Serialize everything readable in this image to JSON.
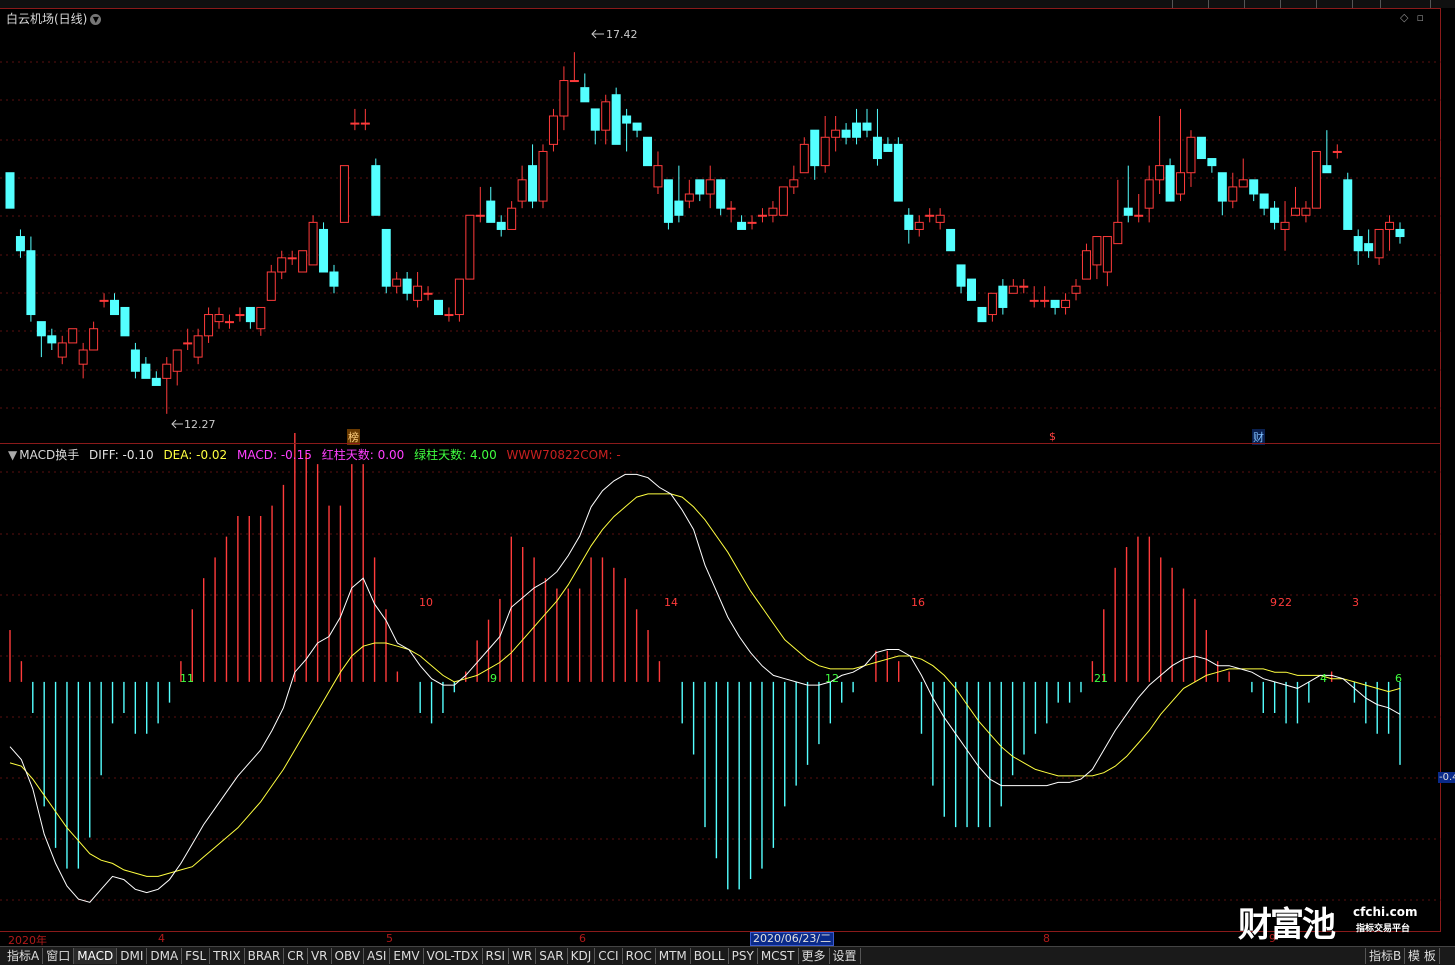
{
  "stock_title": "白云机场(日线)",
  "price_max_label": "17.42",
  "price_min_label": "12.27",
  "markers": {
    "bang": "榜",
    "rong": "$",
    "cai": "财"
  },
  "macd": {
    "name": "MACD换手",
    "diff_label": "DIFF: -0.10",
    "dea_label": "DEA: -0.02",
    "macd_label": "MACD: -0.15",
    "red_days_label": "红柱天数: 0.00",
    "green_days_label": "绿柱天数: 4.00",
    "site_label": "WWW70822COM: -"
  },
  "colors": {
    "up": "#ff3b3b",
    "down": "#54ffff",
    "diff": "#ffffff",
    "dea": "#ffff40",
    "red_bar": "#ff3b3b",
    "green_bar": "#54ffff",
    "grid": "#5a0f0f"
  },
  "dates": {
    "year": "2020年",
    "m4": "4",
    "m5": "5",
    "m6": "6",
    "current": "2020/06/23/二",
    "m8": "8",
    "m9": "9"
  },
  "macd_right_label": "-0.4",
  "bar_counts": [
    {
      "text": "11",
      "color": "green"
    },
    {
      "text": "10",
      "color": "red"
    },
    {
      "text": "9",
      "color": "green"
    },
    {
      "text": "14",
      "color": "red"
    },
    {
      "text": "12",
      "color": "green"
    },
    {
      "text": "16",
      "color": "red"
    },
    {
      "text": "21",
      "color": "green"
    },
    {
      "text": "22",
      "color": "red"
    },
    {
      "text": "9",
      "color": "red"
    },
    {
      "text": "3",
      "color": "red"
    },
    {
      "text": "4",
      "color": "green"
    },
    {
      "text": "6",
      "color": "green"
    }
  ],
  "tabs": [
    "指标A",
    "窗口",
    "MACD",
    "DMI",
    "DMA",
    "FSL",
    "TRIX",
    "BRAR",
    "CR",
    "VR",
    "OBV",
    "ASI",
    "EMV",
    "VOL-TDX",
    "RSI",
    "WR",
    "SAR",
    "KDJ",
    "CCI",
    "ROC",
    "MTM",
    "BOLL",
    "PSY",
    "MCST",
    "更多",
    "设置"
  ],
  "right_tabs": [
    "指标B",
    "模 板"
  ],
  "logo": {
    "main": "财富池",
    "domain": "cfchi.com",
    "tagline": "指标交易平台"
  },
  "candles": [
    {
      "o": 15.7,
      "h": 15.7,
      "l": 15.2,
      "c": 15.2
    },
    {
      "o": 14.8,
      "h": 14.9,
      "l": 14.5,
      "c": 14.6
    },
    {
      "o": 14.6,
      "h": 14.8,
      "l": 13.6,
      "c": 13.7
    },
    {
      "o": 13.6,
      "h": 13.6,
      "l": 13.1,
      "c": 13.4
    },
    {
      "o": 13.4,
      "h": 13.5,
      "l": 13.2,
      "c": 13.3
    },
    {
      "o": 13.1,
      "h": 13.4,
      "l": 13.0,
      "c": 13.3
    },
    {
      "o": 13.3,
      "h": 13.5,
      "l": 13.3,
      "c": 13.5
    },
    {
      "o": 13.0,
      "h": 13.3,
      "l": 12.8,
      "c": 13.2
    },
    {
      "o": 13.2,
      "h": 13.6,
      "l": 13.2,
      "c": 13.5
    },
    {
      "o": 13.9,
      "h": 14.0,
      "l": 13.8,
      "c": 13.9
    },
    {
      "o": 13.9,
      "h": 14.0,
      "l": 13.7,
      "c": 13.7
    },
    {
      "o": 13.8,
      "h": 13.8,
      "l": 13.4,
      "c": 13.4
    },
    {
      "o": 13.2,
      "h": 13.3,
      "l": 12.8,
      "c": 12.9
    },
    {
      "o": 13.0,
      "h": 13.1,
      "l": 12.8,
      "c": 12.8
    },
    {
      "o": 12.8,
      "h": 12.9,
      "l": 12.7,
      "c": 12.7
    },
    {
      "o": 12.8,
      "h": 13.1,
      "l": 12.3,
      "c": 13.0
    },
    {
      "o": 12.9,
      "h": 13.2,
      "l": 12.7,
      "c": 13.2
    },
    {
      "o": 13.3,
      "h": 13.5,
      "l": 13.2,
      "c": 13.3
    },
    {
      "o": 13.1,
      "h": 13.5,
      "l": 13.0,
      "c": 13.4
    },
    {
      "o": 13.4,
      "h": 13.8,
      "l": 13.3,
      "c": 13.7
    },
    {
      "o": 13.6,
      "h": 13.8,
      "l": 13.5,
      "c": 13.7
    },
    {
      "o": 13.6,
      "h": 13.7,
      "l": 13.5,
      "c": 13.6
    },
    {
      "o": 13.7,
      "h": 13.8,
      "l": 13.6,
      "c": 13.7
    },
    {
      "o": 13.8,
      "h": 13.8,
      "l": 13.5,
      "c": 13.6
    },
    {
      "o": 13.5,
      "h": 13.8,
      "l": 13.4,
      "c": 13.8
    },
    {
      "o": 13.9,
      "h": 14.4,
      "l": 13.9,
      "c": 14.3
    },
    {
      "o": 14.3,
      "h": 14.6,
      "l": 14.2,
      "c": 14.5
    },
    {
      "o": 14.5,
      "h": 14.6,
      "l": 14.4,
      "c": 14.5
    },
    {
      "o": 14.3,
      "h": 14.6,
      "l": 14.3,
      "c": 14.6
    },
    {
      "o": 14.4,
      "h": 15.1,
      "l": 14.4,
      "c": 15.0
    },
    {
      "o": 14.9,
      "h": 15.0,
      "l": 14.3,
      "c": 14.3
    },
    {
      "o": 14.3,
      "h": 14.4,
      "l": 14.0,
      "c": 14.1
    },
    {
      "o": 15.0,
      "h": 15.8,
      "l": 15.0,
      "c": 15.8
    },
    {
      "o": 16.4,
      "h": 16.6,
      "l": 16.3,
      "c": 16.4
    },
    {
      "o": 16.4,
      "h": 16.6,
      "l": 16.3,
      "c": 16.4
    },
    {
      "o": 15.8,
      "h": 15.9,
      "l": 15.1,
      "c": 15.1
    },
    {
      "o": 14.9,
      "h": 14.9,
      "l": 14.0,
      "c": 14.1
    },
    {
      "o": 14.1,
      "h": 14.3,
      "l": 14.0,
      "c": 14.2
    },
    {
      "o": 14.2,
      "h": 14.3,
      "l": 13.9,
      "c": 14.0
    },
    {
      "o": 13.9,
      "h": 14.3,
      "l": 13.8,
      "c": 14.1
    },
    {
      "o": 14.0,
      "h": 14.1,
      "l": 13.9,
      "c": 14.0
    },
    {
      "o": 13.9,
      "h": 13.9,
      "l": 13.7,
      "c": 13.7
    },
    {
      "o": 13.7,
      "h": 13.8,
      "l": 13.6,
      "c": 13.7
    },
    {
      "o": 13.7,
      "h": 14.2,
      "l": 13.6,
      "c": 14.2
    },
    {
      "o": 14.2,
      "h": 15.1,
      "l": 14.2,
      "c": 15.1
    },
    {
      "o": 15.1,
      "h": 15.5,
      "l": 15.0,
      "c": 15.1
    },
    {
      "o": 15.3,
      "h": 15.5,
      "l": 15.0,
      "c": 15.0
    },
    {
      "o": 15.0,
      "h": 15.1,
      "l": 14.8,
      "c": 14.9
    },
    {
      "o": 14.9,
      "h": 15.3,
      "l": 14.9,
      "c": 15.2
    },
    {
      "o": 15.3,
      "h": 15.8,
      "l": 15.2,
      "c": 15.6
    },
    {
      "o": 15.8,
      "h": 16.1,
      "l": 15.2,
      "c": 15.3
    },
    {
      "o": 15.3,
      "h": 16.1,
      "l": 15.2,
      "c": 16.0
    },
    {
      "o": 16.1,
      "h": 16.6,
      "l": 16.0,
      "c": 16.5
    },
    {
      "o": 16.5,
      "h": 17.2,
      "l": 16.3,
      "c": 17.0
    },
    {
      "o": 17.0,
      "h": 17.4,
      "l": 17.0,
      "c": 17.0
    },
    {
      "o": 16.9,
      "h": 17.1,
      "l": 16.7,
      "c": 16.7
    },
    {
      "o": 16.6,
      "h": 16.6,
      "l": 16.1,
      "c": 16.3
    },
    {
      "o": 16.3,
      "h": 16.8,
      "l": 16.1,
      "c": 16.7
    },
    {
      "o": 16.8,
      "h": 16.9,
      "l": 16.1,
      "c": 16.1
    },
    {
      "o": 16.5,
      "h": 16.6,
      "l": 16.0,
      "c": 16.4
    },
    {
      "o": 16.4,
      "h": 16.4,
      "l": 16.2,
      "c": 16.3
    },
    {
      "o": 16.2,
      "h": 16.2,
      "l": 15.8,
      "c": 15.8
    },
    {
      "o": 15.5,
      "h": 16.0,
      "l": 15.4,
      "c": 15.8
    },
    {
      "o": 15.6,
      "h": 15.6,
      "l": 14.9,
      "c": 15.0
    },
    {
      "o": 15.3,
      "h": 15.8,
      "l": 15.0,
      "c": 15.1
    },
    {
      "o": 15.3,
      "h": 15.6,
      "l": 15.2,
      "c": 15.4
    },
    {
      "o": 15.6,
      "h": 15.6,
      "l": 15.3,
      "c": 15.4
    },
    {
      "o": 15.4,
      "h": 15.8,
      "l": 15.2,
      "c": 15.6
    },
    {
      "o": 15.6,
      "h": 15.6,
      "l": 15.1,
      "c": 15.2
    },
    {
      "o": 15.2,
      "h": 15.3,
      "l": 15.0,
      "c": 15.2
    },
    {
      "o": 15.0,
      "h": 15.1,
      "l": 14.9,
      "c": 14.9
    },
    {
      "o": 15.0,
      "h": 15.1,
      "l": 14.9,
      "c": 15.0
    },
    {
      "o": 15.1,
      "h": 15.2,
      "l": 15.0,
      "c": 15.1
    },
    {
      "o": 15.1,
      "h": 15.3,
      "l": 15.0,
      "c": 15.2
    },
    {
      "o": 15.1,
      "h": 15.5,
      "l": 15.1,
      "c": 15.5
    },
    {
      "o": 15.5,
      "h": 15.8,
      "l": 15.4,
      "c": 15.6
    },
    {
      "o": 15.7,
      "h": 16.2,
      "l": 15.7,
      "c": 16.1
    },
    {
      "o": 16.3,
      "h": 16.3,
      "l": 15.6,
      "c": 15.8
    },
    {
      "o": 15.8,
      "h": 16.5,
      "l": 15.7,
      "c": 16.2
    },
    {
      "o": 16.2,
      "h": 16.5,
      "l": 16.0,
      "c": 16.3
    },
    {
      "o": 16.3,
      "h": 16.4,
      "l": 16.1,
      "c": 16.2
    },
    {
      "o": 16.4,
      "h": 16.6,
      "l": 16.1,
      "c": 16.2
    },
    {
      "o": 16.4,
      "h": 16.6,
      "l": 16.2,
      "c": 16.3
    },
    {
      "o": 16.2,
      "h": 16.6,
      "l": 15.8,
      "c": 15.9
    },
    {
      "o": 16.1,
      "h": 16.2,
      "l": 16.0,
      "c": 16.0
    },
    {
      "o": 16.1,
      "h": 16.2,
      "l": 15.3,
      "c": 15.3
    },
    {
      "o": 15.1,
      "h": 15.2,
      "l": 14.7,
      "c": 14.9
    },
    {
      "o": 14.9,
      "h": 15.1,
      "l": 14.8,
      "c": 15.0
    },
    {
      "o": 15.1,
      "h": 15.2,
      "l": 15.0,
      "c": 15.1
    },
    {
      "o": 15.0,
      "h": 15.2,
      "l": 14.9,
      "c": 15.1
    },
    {
      "o": 14.9,
      "h": 14.9,
      "l": 14.6,
      "c": 14.6
    },
    {
      "o": 14.4,
      "h": 14.4,
      "l": 14.0,
      "c": 14.1
    },
    {
      "o": 14.2,
      "h": 14.2,
      "l": 13.9,
      "c": 13.9
    },
    {
      "o": 13.8,
      "h": 13.8,
      "l": 13.6,
      "c": 13.6
    },
    {
      "o": 13.7,
      "h": 14.0,
      "l": 13.6,
      "c": 14.0
    },
    {
      "o": 14.1,
      "h": 14.2,
      "l": 13.7,
      "c": 13.8
    },
    {
      "o": 14.0,
      "h": 14.2,
      "l": 14.0,
      "c": 14.1
    },
    {
      "o": 14.1,
      "h": 14.2,
      "l": 14.0,
      "c": 14.1
    },
    {
      "o": 13.9,
      "h": 14.1,
      "l": 13.8,
      "c": 13.9
    },
    {
      "o": 13.9,
      "h": 14.1,
      "l": 13.8,
      "c": 13.9
    },
    {
      "o": 13.9,
      "h": 13.9,
      "l": 13.7,
      "c": 13.8
    },
    {
      "o": 13.8,
      "h": 14.0,
      "l": 13.7,
      "c": 13.9
    },
    {
      "o": 14.0,
      "h": 14.2,
      "l": 13.9,
      "c": 14.1
    },
    {
      "o": 14.2,
      "h": 14.7,
      "l": 14.2,
      "c": 14.6
    },
    {
      "o": 14.4,
      "h": 14.8,
      "l": 14.2,
      "c": 14.8
    },
    {
      "o": 14.3,
      "h": 14.8,
      "l": 14.1,
      "c": 14.8
    },
    {
      "o": 14.7,
      "h": 15.6,
      "l": 14.7,
      "c": 15.0
    },
    {
      "o": 15.2,
      "h": 15.8,
      "l": 15.0,
      "c": 15.1
    },
    {
      "o": 15.1,
      "h": 15.4,
      "l": 15.0,
      "c": 15.1
    },
    {
      "o": 15.2,
      "h": 15.8,
      "l": 15.0,
      "c": 15.6
    },
    {
      "o": 15.6,
      "h": 16.5,
      "l": 15.4,
      "c": 15.8
    },
    {
      "o": 15.8,
      "h": 15.9,
      "l": 15.3,
      "c": 15.3
    },
    {
      "o": 15.4,
      "h": 16.6,
      "l": 15.3,
      "c": 15.7
    },
    {
      "o": 15.7,
      "h": 16.3,
      "l": 15.5,
      "c": 16.2
    },
    {
      "o": 16.2,
      "h": 16.2,
      "l": 15.9,
      "c": 15.9
    },
    {
      "o": 15.9,
      "h": 15.9,
      "l": 15.7,
      "c": 15.8
    },
    {
      "o": 15.7,
      "h": 15.7,
      "l": 15.1,
      "c": 15.3
    },
    {
      "o": 15.3,
      "h": 15.7,
      "l": 15.2,
      "c": 15.5
    },
    {
      "o": 15.5,
      "h": 15.9,
      "l": 15.5,
      "c": 15.6
    },
    {
      "o": 15.6,
      "h": 15.6,
      "l": 15.3,
      "c": 15.4
    },
    {
      "o": 15.4,
      "h": 15.4,
      "l": 15.1,
      "c": 15.2
    },
    {
      "o": 15.2,
      "h": 15.3,
      "l": 14.9,
      "c": 15.0
    },
    {
      "o": 14.9,
      "h": 15.3,
      "l": 14.6,
      "c": 15.0
    },
    {
      "o": 15.1,
      "h": 15.5,
      "l": 15.1,
      "c": 15.2
    },
    {
      "o": 15.1,
      "h": 15.3,
      "l": 15.0,
      "c": 15.2
    },
    {
      "o": 15.2,
      "h": 16.0,
      "l": 15.2,
      "c": 16.0
    },
    {
      "o": 15.8,
      "h": 16.3,
      "l": 15.7,
      "c": 15.7
    },
    {
      "o": 16.0,
      "h": 16.1,
      "l": 15.9,
      "c": 16.0
    },
    {
      "o": 15.6,
      "h": 15.7,
      "l": 14.9,
      "c": 14.9
    },
    {
      "o": 14.8,
      "h": 14.9,
      "l": 14.4,
      "c": 14.6
    },
    {
      "o": 14.7,
      "h": 14.9,
      "l": 14.5,
      "c": 14.6
    },
    {
      "o": 14.5,
      "h": 14.9,
      "l": 14.4,
      "c": 14.9
    },
    {
      "o": 14.9,
      "h": 15.1,
      "l": 14.6,
      "c": 15.0
    },
    {
      "o": 14.9,
      "h": 15.0,
      "l": 14.7,
      "c": 14.8
    }
  ],
  "macd_series": {
    "diff": [
      -0.2,
      -0.24,
      -0.33,
      -0.47,
      -0.56,
      -0.63,
      -0.67,
      -0.68,
      -0.64,
      -0.6,
      -0.61,
      -0.64,
      -0.65,
      -0.64,
      -0.61,
      -0.56,
      -0.5,
      -0.44,
      -0.39,
      -0.34,
      -0.29,
      -0.25,
      -0.21,
      -0.15,
      -0.08,
      0.03,
      0.07,
      0.12,
      0.14,
      0.2,
      0.29,
      0.32,
      0.24,
      0.19,
      0.12,
      0.1,
      0.05,
      0.01,
      -0.01,
      -0.01,
      0.02,
      0.06,
      0.1,
      0.14,
      0.23,
      0.26,
      0.29,
      0.31,
      0.34,
      0.39,
      0.45,
      0.54,
      0.59,
      0.62,
      0.64,
      0.64,
      0.63,
      0.6,
      0.58,
      0.53,
      0.47,
      0.36,
      0.28,
      0.2,
      0.14,
      0.09,
      0.05,
      0.02,
      0.01,
      0.0,
      -0.01,
      -0.01,
      0.0,
      0.02,
      0.03,
      0.05,
      0.09,
      0.1,
      0.1,
      0.08,
      0.02,
      -0.05,
      -0.11,
      -0.16,
      -0.21,
      -0.26,
      -0.3,
      -0.32,
      -0.32,
      -0.32,
      -0.32,
      -0.32,
      -0.31,
      -0.31,
      -0.3,
      -0.27,
      -0.21,
      -0.15,
      -0.1,
      -0.05,
      -0.01,
      0.02,
      0.05,
      0.07,
      0.08,
      0.07,
      0.05,
      0.05,
      0.04,
      0.03,
      0.01,
      0.0,
      -0.01,
      -0.02,
      0.0,
      0.02,
      0.02,
      0.01,
      -0.02,
      -0.05,
      -0.07,
      -0.08,
      -0.1
    ],
    "dea": [
      -0.25,
      -0.26,
      -0.3,
      -0.35,
      -0.4,
      -0.45,
      -0.49,
      -0.53,
      -0.55,
      -0.56,
      -0.58,
      -0.59,
      -0.6,
      -0.6,
      -0.59,
      -0.58,
      -0.57,
      -0.54,
      -0.51,
      -0.48,
      -0.45,
      -0.41,
      -0.37,
      -0.32,
      -0.27,
      -0.21,
      -0.15,
      -0.09,
      -0.03,
      0.03,
      0.08,
      0.11,
      0.12,
      0.12,
      0.11,
      0.1,
      0.08,
      0.05,
      0.02,
      0.0,
      0.01,
      0.02,
      0.04,
      0.06,
      0.09,
      0.13,
      0.17,
      0.21,
      0.25,
      0.3,
      0.36,
      0.42,
      0.47,
      0.51,
      0.54,
      0.57,
      0.58,
      0.58,
      0.58,
      0.57,
      0.54,
      0.5,
      0.45,
      0.4,
      0.34,
      0.28,
      0.23,
      0.18,
      0.13,
      0.1,
      0.07,
      0.05,
      0.04,
      0.04,
      0.04,
      0.05,
      0.06,
      0.07,
      0.08,
      0.08,
      0.07,
      0.05,
      0.02,
      -0.02,
      -0.07,
      -0.12,
      -0.16,
      -0.2,
      -0.23,
      -0.25,
      -0.27,
      -0.28,
      -0.29,
      -0.29,
      -0.29,
      -0.29,
      -0.28,
      -0.26,
      -0.23,
      -0.19,
      -0.15,
      -0.1,
      -0.06,
      -0.02,
      0.0,
      0.02,
      0.03,
      0.04,
      0.04,
      0.04,
      0.04,
      0.03,
      0.03,
      0.02,
      0.02,
      0.02,
      0.01,
      0.01,
      0.0,
      -0.01,
      -0.02,
      -0.03,
      -0.02
    ]
  }
}
